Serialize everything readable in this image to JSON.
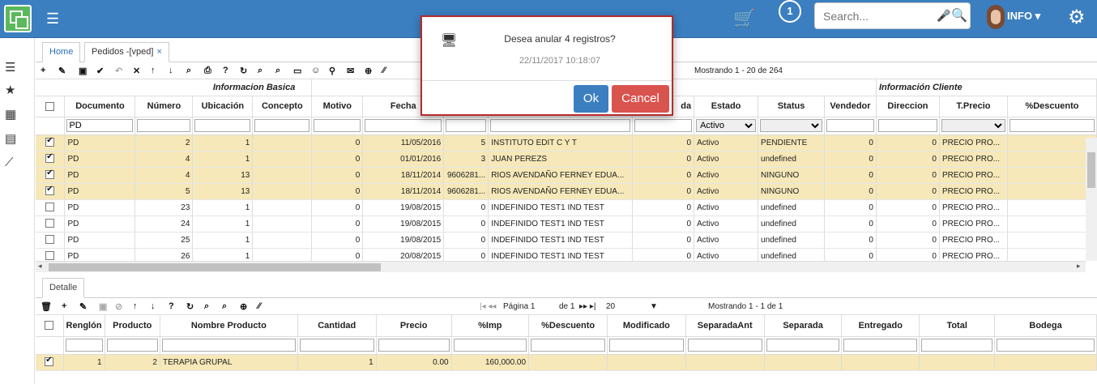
{
  "topbar": {
    "notification_count": "1",
    "search_placeholder": "Search...",
    "user_label": "INFO"
  },
  "tabs": [
    {
      "label": "Home"
    },
    {
      "label": "Pedidos -[vped]"
    }
  ],
  "toolbar": {
    "status": "Mostrando 1 - 20 de 264"
  },
  "main_grid": {
    "groups": {
      "basic": "Informacion Basica",
      "client": "Información Cliente"
    },
    "columns": [
      "Documento",
      "Número",
      "Ubicación",
      "Concepto",
      "Motivo",
      "Fecha",
      "",
      "",
      "da",
      "Estado",
      "Status",
      "Vendedor",
      "Direccion",
      "T.Precio",
      "%Descuento"
    ],
    "filters": {
      "documento": "PD",
      "estado": "Activo",
      "status": ""
    },
    "rows": [
      {
        "checked": true,
        "cells": [
          "PD",
          "2",
          "1",
          "",
          "0",
          "11/05/2016",
          "5",
          "INSTITUTO EDIT C Y T",
          "0",
          "Activo",
          "PENDIENTE",
          "0",
          "0",
          "PRECIO PRO..."
        ]
      },
      {
        "checked": true,
        "cells": [
          "PD",
          "4",
          "1",
          "",
          "0",
          "01/01/2016",
          "3",
          "JUAN PEREZS",
          "0",
          "Activo",
          "undefined",
          "0",
          "0",
          "PRECIO PRO..."
        ]
      },
      {
        "checked": true,
        "cells": [
          "PD",
          "4",
          "13",
          "",
          "0",
          "18/11/2014",
          "9606281...",
          "RIOS AVENDAÑO FERNEY EDUA...",
          "0",
          "Activo",
          "NINGUNO",
          "0",
          "0",
          "PRECIO PRO..."
        ]
      },
      {
        "checked": true,
        "cells": [
          "PD",
          "5",
          "13",
          "",
          "0",
          "18/11/2014",
          "9606281...",
          "RIOS AVENDAÑO FERNEY EDUA...",
          "0",
          "Activo",
          "NINGUNO",
          "0",
          "0",
          "PRECIO PRO..."
        ]
      },
      {
        "checked": false,
        "cells": [
          "PD",
          "23",
          "1",
          "",
          "0",
          "19/08/2015",
          "0",
          "INDEFINIDO TEST1 IND TEST",
          "0",
          "Activo",
          "undefined",
          "0",
          "0",
          "PRECIO PRO..."
        ]
      },
      {
        "checked": false,
        "cells": [
          "PD",
          "24",
          "1",
          "",
          "0",
          "19/08/2015",
          "0",
          "INDEFINIDO TEST1 IND TEST",
          "0",
          "Activo",
          "undefined",
          "0",
          "0",
          "PRECIO PRO..."
        ]
      },
      {
        "checked": false,
        "cells": [
          "PD",
          "25",
          "1",
          "",
          "0",
          "19/08/2015",
          "0",
          "INDEFINIDO TEST1 IND TEST",
          "0",
          "Activo",
          "undefined",
          "0",
          "0",
          "PRECIO PRO..."
        ]
      },
      {
        "checked": false,
        "cells": [
          "PD",
          "26",
          "1",
          "",
          "0",
          "20/08/2015",
          "0",
          "INDEFINIDO TEST1 IND TEST",
          "0",
          "Activo",
          "undefined",
          "0",
          "0",
          "PRECIO PRO..."
        ]
      }
    ]
  },
  "detail": {
    "tab_label": "Detalle",
    "pager": {
      "page_label": "Página 1",
      "of_label": "de 1",
      "page_size": "20",
      "status": "Mostrando 1 - 1 de 1"
    },
    "columns": [
      "Renglón",
      "Producto",
      "Nombre Producto",
      "Cantidad",
      "Precio",
      "%Imp",
      "%Descuento",
      "Modificado",
      "SeparadaAnt",
      "Separada",
      "Entregado",
      "Total",
      "Bodega"
    ],
    "rows": [
      {
        "checked": true,
        "cells": [
          "1",
          "2",
          "TERAPIA GRUPAL",
          "1",
          "0.00",
          "160,000.00",
          "",
          "",
          "",
          "",
          "",
          "",
          ""
        ]
      }
    ]
  },
  "dialog": {
    "message": "Desea anular 4 registros?",
    "timestamp": "22/11/2017 10:18:07",
    "ok_label": "Ok",
    "cancel_label": "Cancel"
  },
  "colors": {
    "topbar": "#3b7fc0",
    "selected_row": "#f6e8b8",
    "ok": "#3b7fc0",
    "cancel": "#d9534f",
    "dialog_border": "#b52a2a"
  }
}
